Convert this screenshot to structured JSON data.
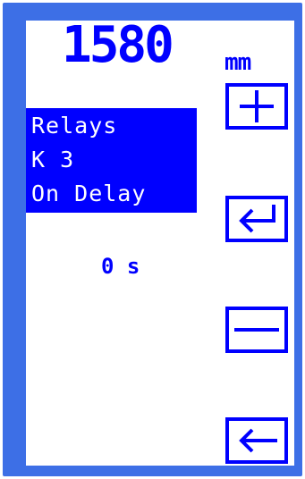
{
  "display": {
    "main_value": "1580",
    "unit": "mm"
  },
  "menu": {
    "lines": [
      "Relays",
      "K 3",
      "On Delay"
    ]
  },
  "setting": {
    "value": "0 s"
  },
  "keys": [
    {
      "name": "plus-key",
      "icon": "plus-icon"
    },
    {
      "name": "enter-key",
      "icon": "enter-icon"
    },
    {
      "name": "minus-key",
      "icon": "minus-icon"
    },
    {
      "name": "back-key",
      "icon": "back-arrow-icon"
    }
  ],
  "colors": {
    "frame": "#3d6fe6",
    "accent": "#0000ff",
    "screen": "#ffffff"
  }
}
